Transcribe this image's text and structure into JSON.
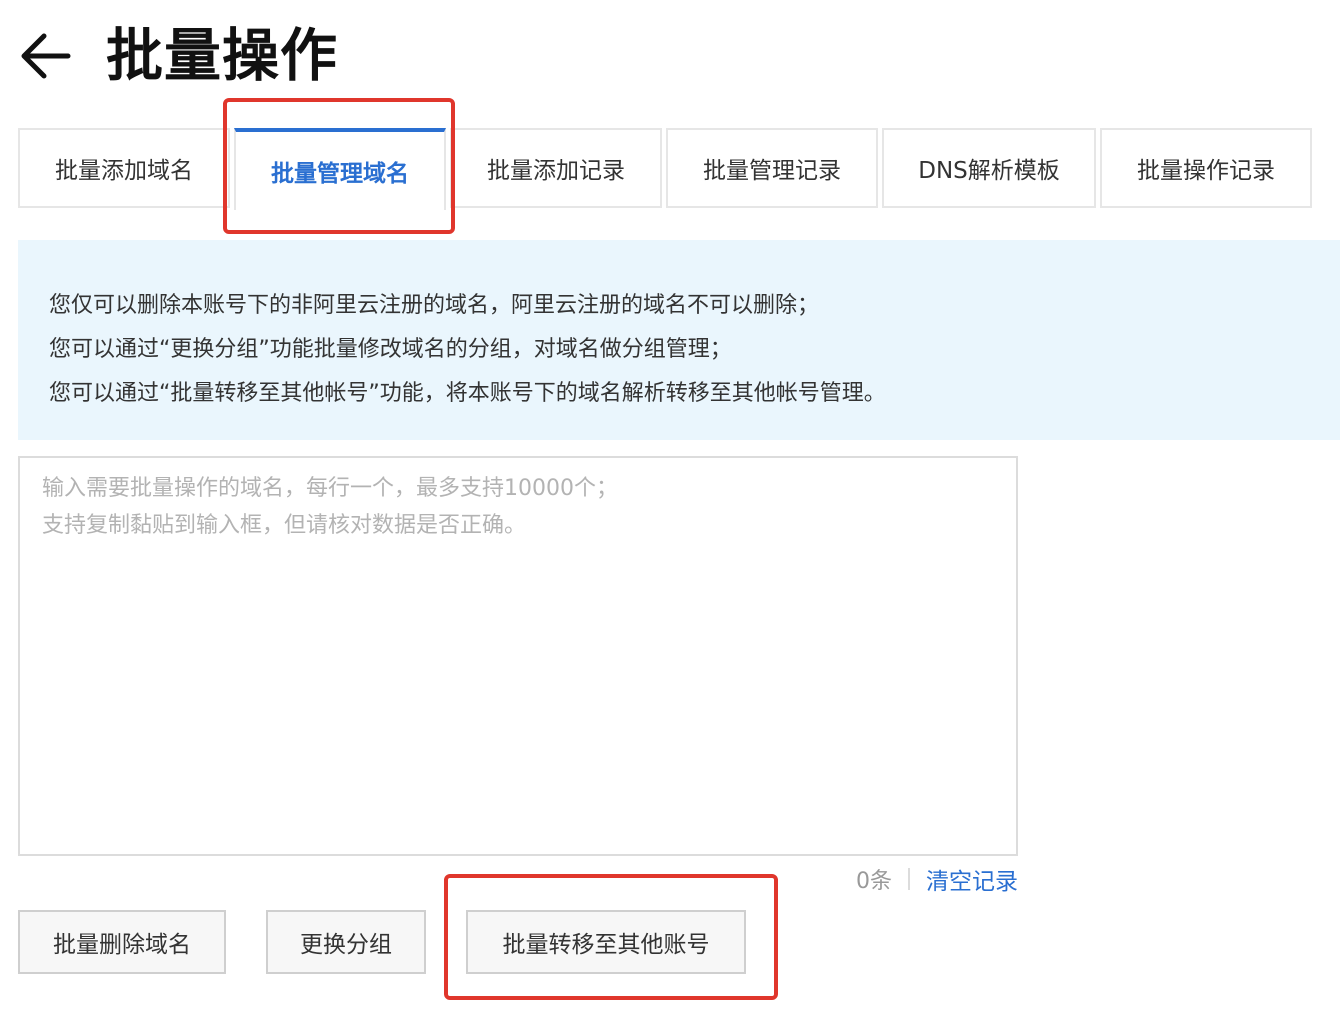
{
  "header": {
    "title": "批量操作",
    "back_icon": "arrow-left-icon"
  },
  "tabs": [
    {
      "label": "批量添加域名",
      "active": false
    },
    {
      "label": "批量管理域名",
      "active": true
    },
    {
      "label": "批量添加记录",
      "active": false
    },
    {
      "label": "批量管理记录",
      "active": false
    },
    {
      "label": "DNS解析模板",
      "active": false
    },
    {
      "label": "批量操作记录",
      "active": false
    }
  ],
  "notice": {
    "lines": [
      "您仅可以删除本账号下的非阿里云注册的域名，阿里云注册的域名不可以删除；",
      "您可以通过“更换分组”功能批量修改域名的分组，对域名做分组管理；",
      "您可以通过“批量转移至其他帐号”功能，将本账号下的域名解析转移至其他帐号管理。"
    ]
  },
  "domain_input": {
    "value": "",
    "placeholder": "输入需要批量操作的域名，每行一个，最多支持10000个；\n支持复制黏贴到输入框，但请核对数据是否正确。"
  },
  "counter": {
    "count_text": "0条",
    "clear_label": "清空记录"
  },
  "actions": {
    "delete_label": "批量删除域名",
    "change_group_label": "更换分组",
    "transfer_label": "批量转移至其他账号"
  },
  "colors": {
    "accent": "#2a6fd1",
    "notice_bg": "#eaf6fd",
    "annotation": "#e0362c"
  }
}
